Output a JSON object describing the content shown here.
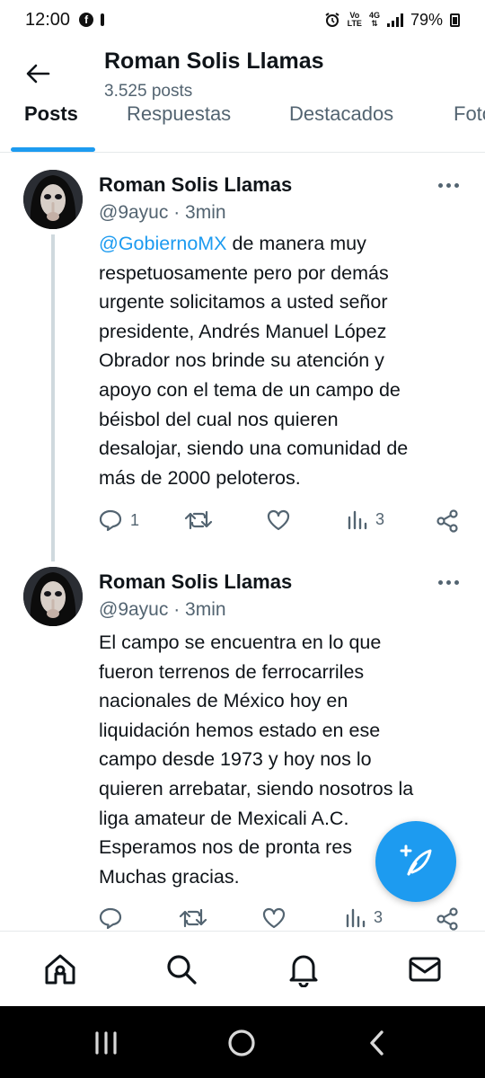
{
  "status_bar": {
    "time": "12:00",
    "volte_label_top": "Vo",
    "volte_label_bottom": "LTE",
    "network_label": "4G",
    "battery": "79%"
  },
  "header": {
    "name": "Roman Solis Llamas",
    "post_count": "3.525 posts"
  },
  "tabs": [
    {
      "label": "Posts",
      "active": true
    },
    {
      "label": "Respuestas",
      "active": false
    },
    {
      "label": "Destacados",
      "active": false
    },
    {
      "label": "Fotos",
      "active": false
    }
  ],
  "tweets": [
    {
      "display_name": "Roman Solis Llamas",
      "meta": "@9ayuc · 3min",
      "mention": "@GobiernoMX",
      "lines": [
        " de manera muy",
        "respetuosamente  pero por demás",
        "urgente solicitamos a usted señor",
        "presidente, Andrés Manuel López",
        "Obrador nos brinde su atención y",
        "apoyo con el tema de un campo de",
        "béisbol del  cual nos quieren",
        "desalojar, siendo una comunidad de",
        "más de 2000 peloteros."
      ],
      "replies": "1",
      "views": "3"
    },
    {
      "display_name": "Roman Solis Llamas",
      "meta": "@9ayuc · 3min",
      "lines": [
        "El campo se encuentra en lo que",
        "fueron terrenos de ferrocarriles",
        "nacionales de México hoy en",
        "liquidación hemos estado en ese",
        "campo desde 1973 y hoy nos lo",
        "quieren arrebatar, siendo nosotros la",
        "liga amateur de Mexicali A.C.",
        "Esperamos nos de pronta res",
        "Muchas gracias."
      ],
      "replies": "",
      "views": "3"
    }
  ],
  "icons": {
    "back": "back-arrow-icon",
    "more": "more-horizontal-icon",
    "reply": "reply-icon",
    "retweet": "retweet-icon",
    "like": "heart-icon",
    "views": "views-chart-icon",
    "share": "share-icon",
    "compose": "compose-post-icon",
    "home": "home-icon",
    "search": "search-icon",
    "notifications": "bell-icon",
    "messages": "mail-icon"
  },
  "colors": {
    "accent": "#1d9bf0",
    "text_primary": "#0f1419",
    "text_secondary": "#536471"
  }
}
